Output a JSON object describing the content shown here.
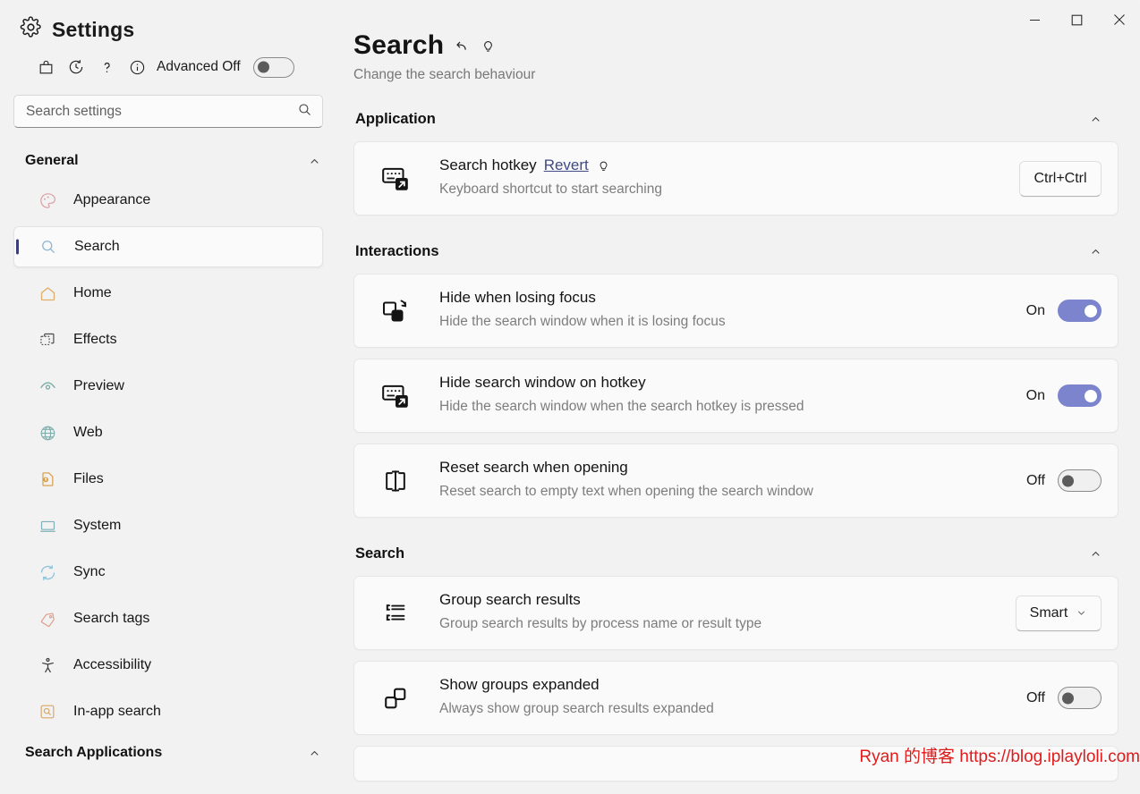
{
  "window": {
    "title": "Settings",
    "controls": {
      "minimize": "minimize-icon",
      "maximize": "maximize-icon",
      "close": "close-icon"
    }
  },
  "sidebar": {
    "toolbar": {
      "bag_icon": "bag-icon",
      "history_icon": "history-icon",
      "help_icon": "question-mark-icon",
      "info_icon": "info-icon",
      "advanced_label": "Advanced Off",
      "advanced_state": "off"
    },
    "search": {
      "value": "",
      "placeholder": "Search settings",
      "icon": "search-icon"
    },
    "groups": [
      {
        "label": "General",
        "collapsed": false,
        "items": [
          {
            "label": "Appearance",
            "icon": "palette-icon",
            "color": "#d9a0a4",
            "active": false
          },
          {
            "label": "Search",
            "icon": "search-icon",
            "color": "#8fb7d4",
            "active": true
          },
          {
            "label": "Home",
            "icon": "home-icon",
            "color": "#e0ae6a",
            "active": false
          },
          {
            "label": "Effects",
            "icon": "layers-icon",
            "color": "#4a4a4a",
            "active": false
          },
          {
            "label": "Preview",
            "icon": "eye-icon",
            "color": "#6fa8a0",
            "active": false
          },
          {
            "label": "Web",
            "icon": "globe-icon",
            "color": "#7fb0ae",
            "active": false
          },
          {
            "label": "Files",
            "icon": "file-upload-icon",
            "color": "#d69b43",
            "active": false
          },
          {
            "label": "System",
            "icon": "monitor-icon",
            "color": "#7fb0b8",
            "active": false
          },
          {
            "label": "Sync",
            "icon": "sync-icon",
            "color": "#8ec4dc",
            "active": false
          },
          {
            "label": "Search tags",
            "icon": "tag-icon",
            "color": "#e0a08e",
            "active": false
          },
          {
            "label": "Accessibility",
            "icon": "accessibility-icon",
            "color": "#4a4a4a",
            "active": false
          },
          {
            "label": "In-app search",
            "icon": "in-app-search-icon",
            "color": "#d6a766",
            "active": false
          }
        ]
      },
      {
        "label": "Search Applications",
        "collapsed": false,
        "items": []
      }
    ]
  },
  "main": {
    "title": "Search",
    "title_icons": [
      "revert-icon",
      "lightbulb-icon"
    ],
    "subtitle": "Change the search behaviour",
    "sections": [
      {
        "label": "Application",
        "rows": [
          {
            "icon": "keyboard-shortcut-icon",
            "title": "Search hotkey",
            "link": "Revert",
            "hint_icon": "lightbulb-icon",
            "desc": "Keyboard shortcut to start searching",
            "control": "button",
            "value": "Ctrl+Ctrl"
          }
        ]
      },
      {
        "label": "Interactions",
        "rows": [
          {
            "icon": "window-focus-icon",
            "title": "Hide when losing focus",
            "desc": "Hide the search window when it is losing focus",
            "control": "toggle",
            "state": "On"
          },
          {
            "icon": "keyboard-shortcut-icon",
            "title": "Hide search window on hotkey",
            "desc": "Hide the search window when the search hotkey is pressed",
            "control": "toggle",
            "state": "On"
          },
          {
            "icon": "reset-width-icon",
            "title": "Reset search when opening",
            "desc": "Reset search to empty text when opening the search window",
            "control": "toggle",
            "state": "Off"
          }
        ]
      },
      {
        "label": "Search",
        "rows": [
          {
            "icon": "grouped-list-icon",
            "title": "Group search results",
            "desc": "Group search results by process name or result type",
            "control": "dropdown",
            "value": "Smart"
          },
          {
            "icon": "groups-expanded-icon",
            "title": "Show groups expanded",
            "desc": "Always show group search results expanded",
            "control": "toggle",
            "state": "Off"
          }
        ]
      }
    ]
  },
  "watermark": "Ryan 的博客 https://blog.iplayloli.com",
  "colors": {
    "accent_on": "#7b84cd",
    "link": "#3f4a86",
    "active_bar": "#3b3f7a",
    "watermark": "#e01b1b"
  }
}
